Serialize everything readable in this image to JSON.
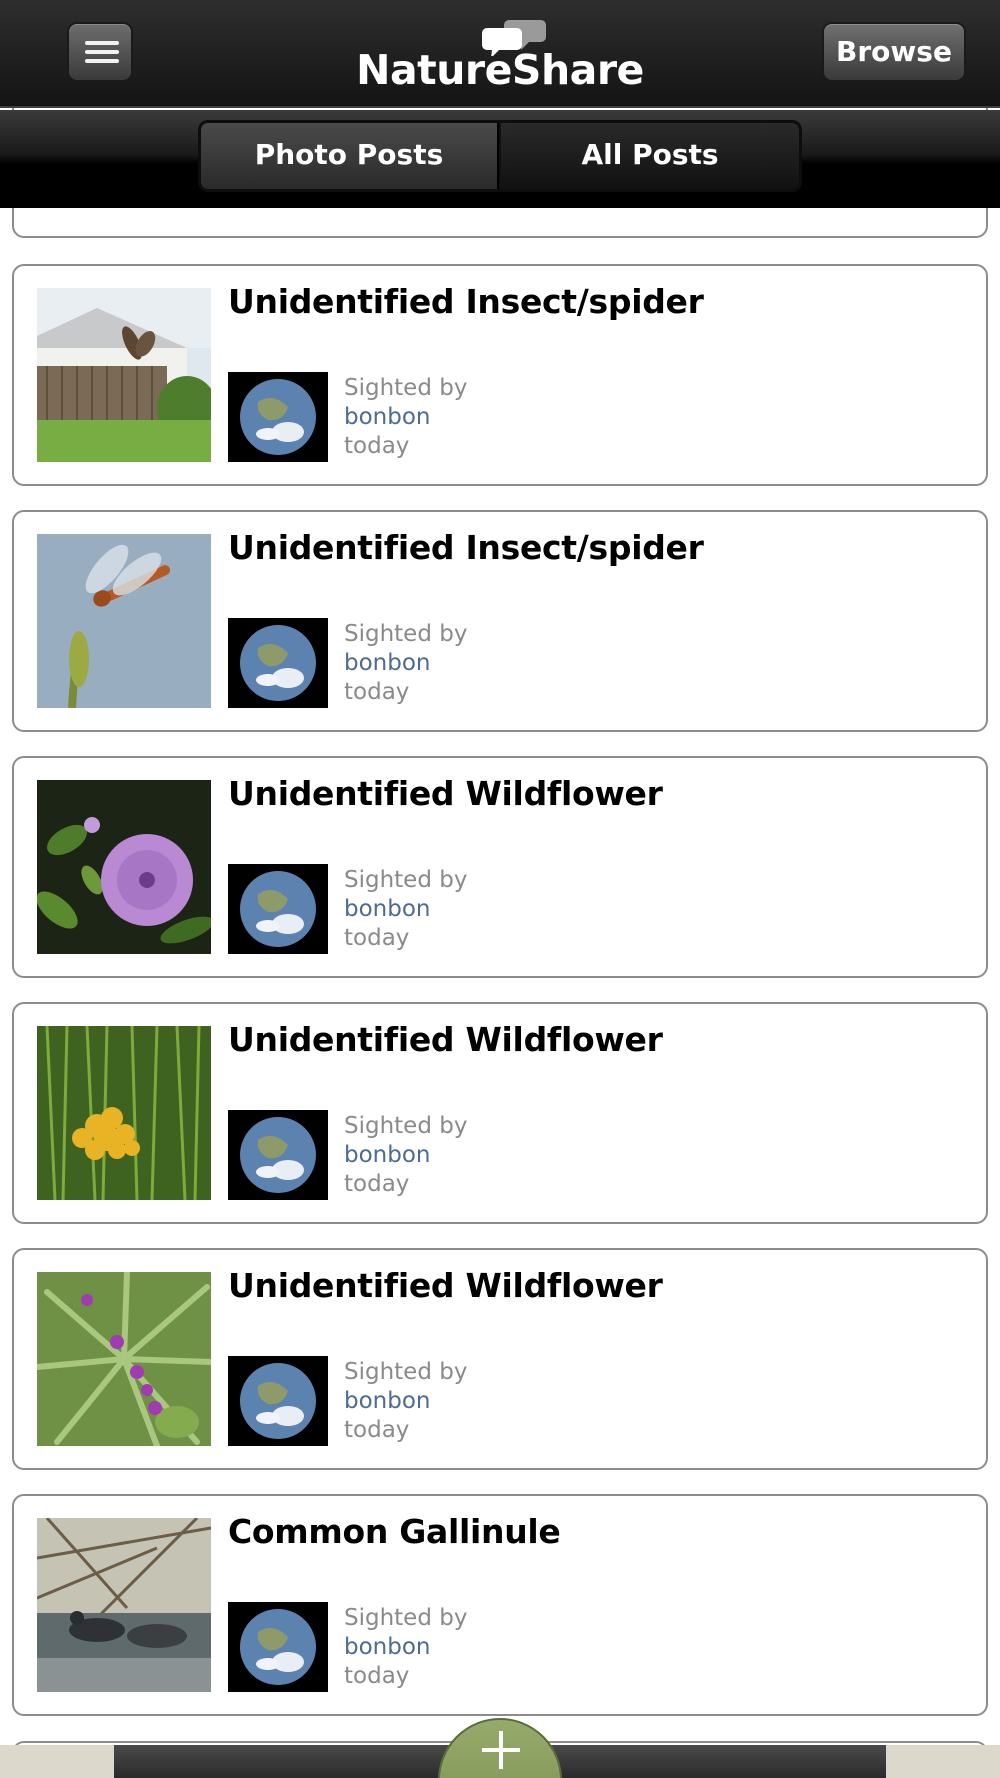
{
  "app": {
    "title": "NatureShare",
    "brand_color": "#141414",
    "link_color": "#4d6c8f"
  },
  "header": {
    "menu_icon": "hamburger-menu-icon",
    "browse_label": "Browse"
  },
  "tabs": [
    {
      "label": "Photo Posts",
      "selected": true
    },
    {
      "label": "All Posts",
      "selected": false
    }
  ],
  "posts": [
    {
      "title": "Unidentified Insect/spider",
      "sighted_label": "Sighted by",
      "user": "bonbon",
      "when": "today",
      "thumb": "moth-over-fence"
    },
    {
      "title": "Unidentified Insect/spider",
      "sighted_label": "Sighted by",
      "user": "bonbon",
      "when": "today",
      "thumb": "dragonfly"
    },
    {
      "title": "Unidentified Wildflower",
      "sighted_label": "Sighted by",
      "user": "bonbon",
      "when": "today",
      "thumb": "purple-morning-glory"
    },
    {
      "title": "Unidentified Wildflower",
      "sighted_label": "Sighted by",
      "user": "bonbon",
      "when": "today",
      "thumb": "yellow-goldenrod"
    },
    {
      "title": "Unidentified Wildflower",
      "sighted_label": "Sighted by",
      "user": "bonbon",
      "when": "today",
      "thumb": "purple-berries-palm"
    },
    {
      "title": "Common Gallinule",
      "sighted_label": "Sighted by",
      "user": "bonbon",
      "when": "today",
      "thumb": "gallinule-in-water"
    }
  ],
  "bottom": {
    "add_icon": "plus-icon"
  }
}
